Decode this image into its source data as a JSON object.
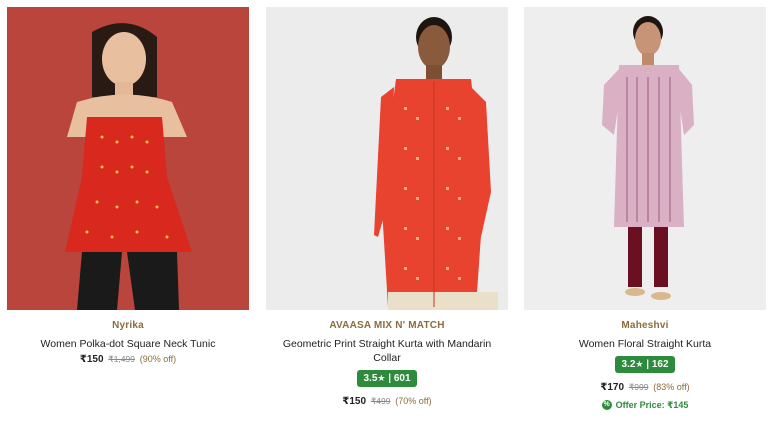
{
  "products": [
    {
      "brand": "Nyrika",
      "title": "Women Polka-dot Square Neck Tunic",
      "price": "₹150",
      "mrp": "₹1,499",
      "discount": "(90% off)"
    },
    {
      "brand": "AVAASA MIX N' MATCH",
      "title": "Geometric Print Straight Kurta with Mandarin Collar",
      "rating": "3.5",
      "rating_count": "601",
      "price": "₹150",
      "mrp": "₹499",
      "discount": "(70% off)"
    },
    {
      "brand": "Maheshvi",
      "title": "Women Floral Straight Kurta",
      "rating": "3.2",
      "rating_count": "162",
      "price": "₹170",
      "mrp": "₹999",
      "discount": "(83% off)",
      "offer_label": "Offer Price: ₹145"
    }
  ],
  "icons": {
    "star": "star-icon",
    "offer": "offer-tag-icon"
  },
  "colors": {
    "rating_bg": "#2e8b3c",
    "brand_text": "#8a6d3b",
    "offer_text": "#2e8b3c"
  }
}
